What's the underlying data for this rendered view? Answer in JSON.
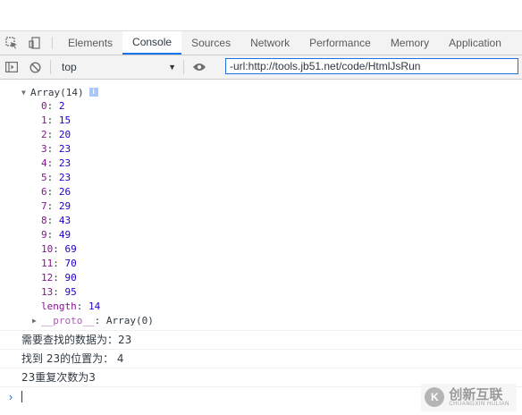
{
  "devtools": {
    "tabs": [
      "Elements",
      "Console",
      "Sources",
      "Network",
      "Performance",
      "Memory",
      "Application"
    ],
    "active_tab": "Console"
  },
  "toolbar": {
    "context": "top",
    "filter_value": "-url:http://tools.jb51.net/code/HtmlJsRun"
  },
  "console": {
    "array_header": "Array(14)",
    "info_badge": "i",
    "items": [
      {
        "key": "0",
        "value": "2"
      },
      {
        "key": "1",
        "value": "15"
      },
      {
        "key": "2",
        "value": "20"
      },
      {
        "key": "3",
        "value": "23"
      },
      {
        "key": "4",
        "value": "23"
      },
      {
        "key": "5",
        "value": "23"
      },
      {
        "key": "6",
        "value": "26"
      },
      {
        "key": "7",
        "value": "29"
      },
      {
        "key": "8",
        "value": "43"
      },
      {
        "key": "9",
        "value": "49"
      },
      {
        "key": "10",
        "value": "69"
      },
      {
        "key": "11",
        "value": "70"
      },
      {
        "key": "12",
        "value": "90"
      },
      {
        "key": "13",
        "value": "95"
      }
    ],
    "length_key": "length",
    "length_value": "14",
    "proto_key": "__proto__",
    "proto_value": "Array(0)",
    "log_lines": [
      "需要查找的数据为：23",
      "找到 23的位置为： 4",
      "23重复次数为3"
    ],
    "prompt_symbol": "›"
  },
  "watermark": {
    "logo": "K",
    "main": "创新互联",
    "sub": "CHUANGXIN HULIAN"
  }
}
